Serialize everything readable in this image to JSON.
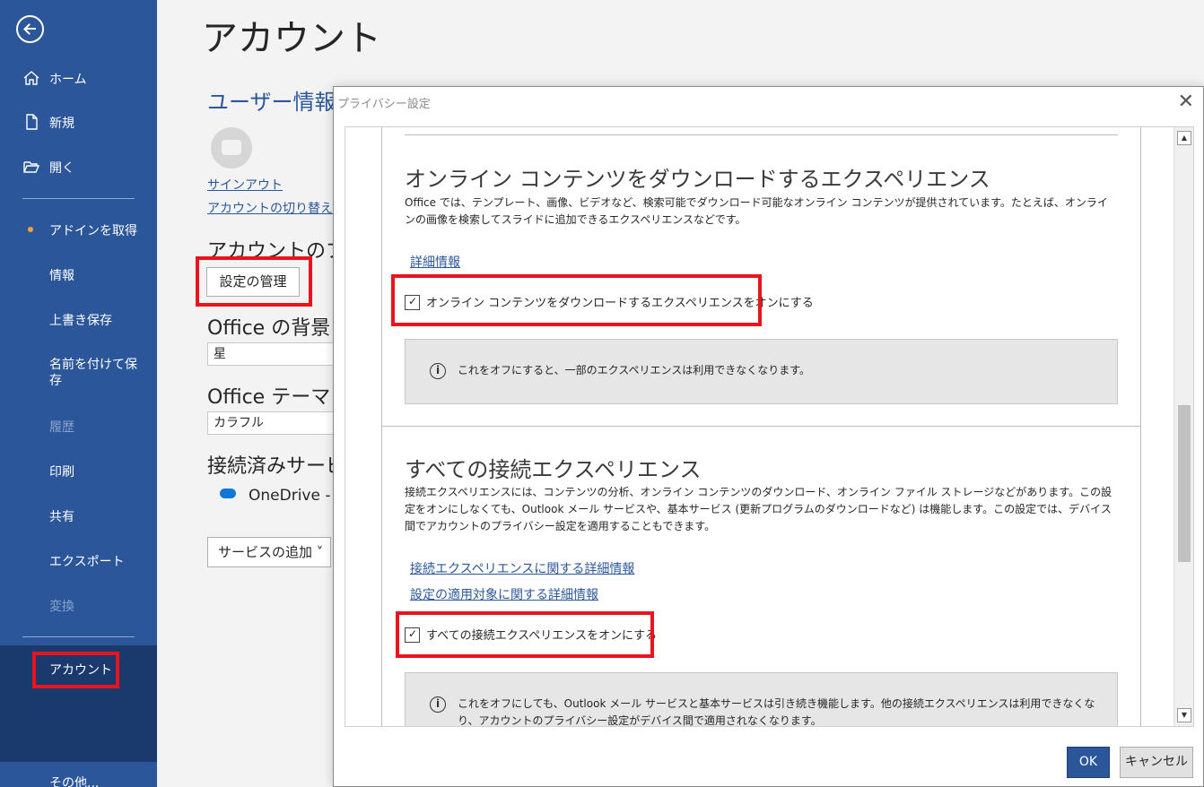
{
  "sidebar": {
    "items": [
      {
        "label": "ホーム",
        "icon": "home-icon"
      },
      {
        "label": "新規",
        "icon": "new-document-icon"
      },
      {
        "label": "開く",
        "icon": "folder-open-icon"
      },
      {
        "label": "アドインを取得"
      },
      {
        "label": "情報"
      },
      {
        "label": "上書き保存"
      },
      {
        "label": "名前を付けて保存"
      },
      {
        "label": "履歴"
      },
      {
        "label": "印刷"
      },
      {
        "label": "共有"
      },
      {
        "label": "エクスポート"
      },
      {
        "label": "変換"
      },
      {
        "label": "アカウント"
      },
      {
        "label": "その他..."
      }
    ]
  },
  "main": {
    "title": "アカウント",
    "user_info_heading": "ユーザー情報",
    "sign_out": "サインアウト",
    "switch_account": "アカウントの切り替え",
    "privacy_heading": "アカウントのプライ",
    "manage_settings": "設定の管理",
    "background_heading": "Office の背景",
    "background_value": "星",
    "theme_heading": "Office テーマ",
    "theme_value": "カラフル",
    "connected_heading": "接続済みサービ",
    "onedrive": "OneDrive -",
    "add_service": "サービスの追加 ˅"
  },
  "dialog": {
    "title": "プライバシー設定",
    "close": "✕",
    "section1": {
      "heading": "オンライン コンテンツをダウンロードするエクスペリエンス",
      "body": "Office では、テンプレート、画像、ビデオなど、検索可能でダウンロード可能なオンライン コンテンツが提供されています。たとえば、オンラインの画像を検索してスライドに追加できるエクスペリエンスなどです。",
      "link": "詳細情報",
      "checkbox": "オンライン コンテンツをダウンロードするエクスペリエンスをオンにする",
      "info": "これをオフにすると、一部のエクスペリエンスは利用できなくなります。"
    },
    "section2": {
      "heading": "すべての接続エクスペリエンス",
      "body": "接続エクスペリエンスには、コンテンツの分析、オンライン コンテンツのダウンロード、オンライン ファイル ストレージなどがあります。この設定をオンにしなくても、Outlook メール サービスや、基本サービス (更新プログラムのダウンロードなど) は機能します。この設定では、デバイス間でアカウントのプライバシー設定を適用することもできます。",
      "link1": "接続エクスペリエンスに関する詳細情報",
      "link2": "設定の適用対象に関する詳細情報",
      "checkbox": "すべての接続エクスペリエンスをオンにする",
      "info": "これをオフにしても、Outlook メール サービスと基本サービスは引き続き機能します。他の接続エクスペリエンスは利用できなくなり、アカウントのプライバシー設定がデバイス間で適用されなくなります。"
    },
    "info_icon": "i",
    "ok": "OK",
    "cancel": "キャンセル"
  },
  "colors": {
    "sidebar": "#2b579a",
    "sidebar_active": "#1a3a6e",
    "highlight": "#e8141e",
    "accent": "#2b579a"
  }
}
